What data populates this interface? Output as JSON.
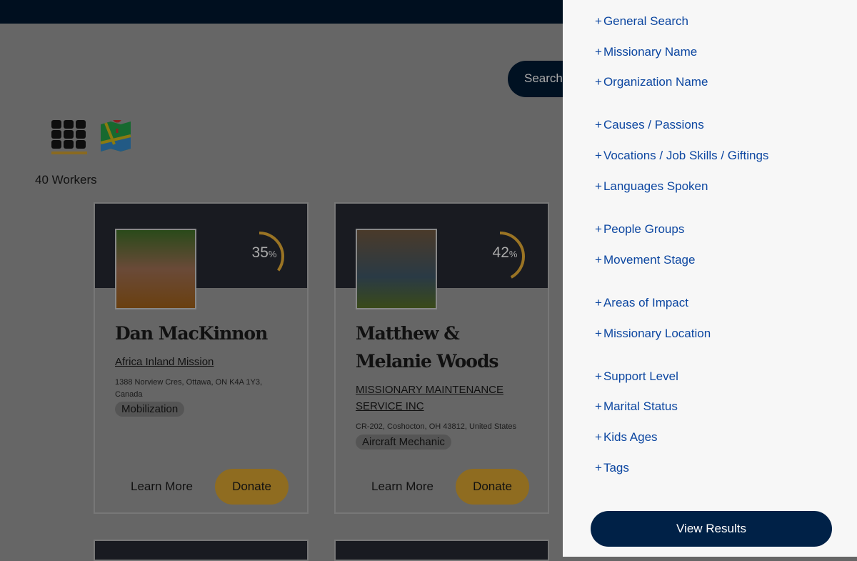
{
  "header": {
    "search_label": "Search"
  },
  "view_toggle": {
    "grid_icon": "grid-icon",
    "map_icon": "map-icon"
  },
  "results": {
    "count_label": "40 Workers"
  },
  "cards": [
    {
      "name": "Dan MacKinnon",
      "percent": "35",
      "percent_sign": "%",
      "progress": 0.35,
      "organization": "Africa Inland Mission",
      "address": "1388 Norview Cres, Ottawa, ON K4A 1Y3, Canada",
      "tag": "Mobilization",
      "learn_more": "Learn More",
      "donate": "Donate"
    },
    {
      "name": "Matthew & Melanie Woods",
      "percent": "42",
      "percent_sign": "%",
      "progress": 0.42,
      "organization": "MISSIONARY MAINTENANCE SERVICE INC",
      "address": "CR-202, Coshocton, OH 43812, United States",
      "tag": "Aircraft Mechanic",
      "learn_more": "Learn More",
      "donate": "Donate"
    }
  ],
  "filters": {
    "plus": "+",
    "items": [
      "General Search",
      "Missionary Name",
      "Organization Name",
      "Causes / Passions",
      "Vocations / Job Skills / Giftings",
      "Languages Spoken",
      "People Groups",
      "Movement Stage",
      "Areas of Impact",
      "Missionary Location",
      "Support Level",
      "Marital Status",
      "Kids Ages",
      "Tags"
    ],
    "view_results": "View Results"
  },
  "colors": {
    "accent": "#f5b72c",
    "navy": "#002147",
    "link": "#0d47a1"
  }
}
